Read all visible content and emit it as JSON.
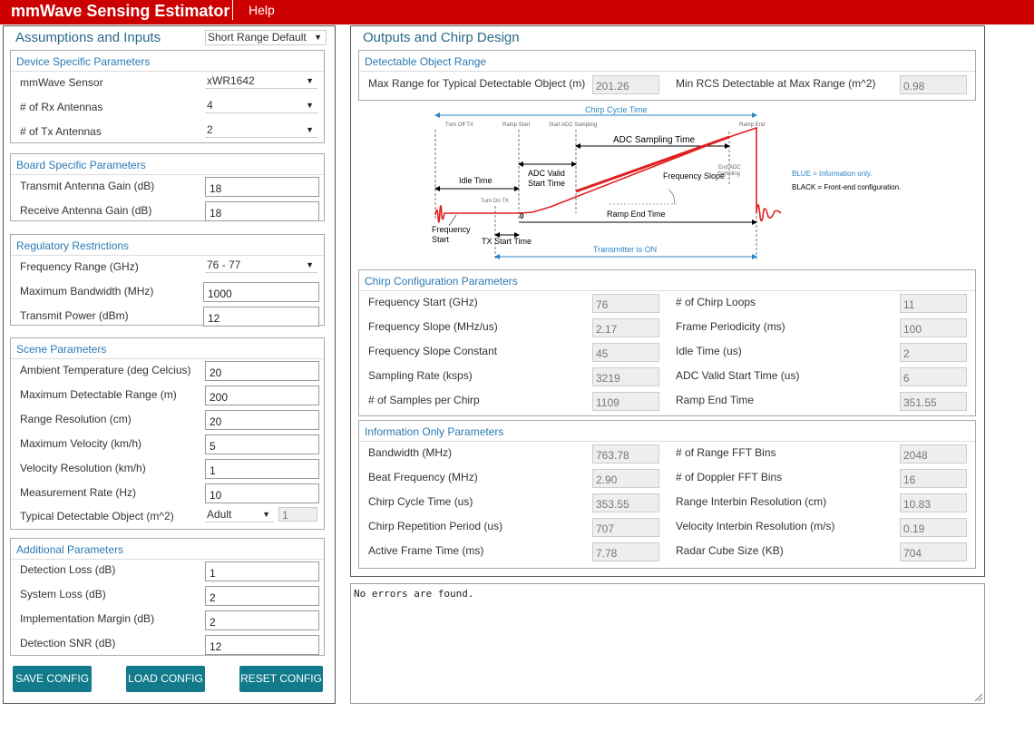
{
  "header": {
    "title": "mmWave Sensing Estimator",
    "help": "Help"
  },
  "left": {
    "title": "Assumptions and Inputs",
    "preset": "Short Range Default",
    "device": {
      "title": "Device Specific Parameters",
      "sensor_label": "mmWave Sensor",
      "sensor": "xWR1642",
      "rx_label": "# of Rx Antennas",
      "rx": "4",
      "tx_label": "# of Tx Antennas",
      "tx": "2"
    },
    "board": {
      "title": "Board Specific Parameters",
      "tx_gain_label": "Transmit Antenna Gain (dB)",
      "tx_gain": "18",
      "rx_gain_label": "Receive Antenna Gain (dB)",
      "rx_gain": "18"
    },
    "regulatory": {
      "title": "Regulatory Restrictions",
      "freq_label": "Frequency Range (GHz)",
      "freq": "76 - 77",
      "bw_label": "Maximum Bandwidth (MHz)",
      "bw": "1000",
      "power_label": "Transmit Power (dBm)",
      "power": "12"
    },
    "scene": {
      "title": "Scene Parameters",
      "temp_label": "Ambient Temperature (deg Celcius)",
      "temp": "20",
      "range_label": "Maximum Detectable Range (m)",
      "range": "200",
      "res_label": "Range Resolution (cm)",
      "res": "20",
      "vel_label": "Maximum Velocity (km/h)",
      "vel": "5",
      "velres_label": "Velocity Resolution (km/h)",
      "velres": "1",
      "rate_label": "Measurement Rate (Hz)",
      "rate": "10",
      "obj_label": "Typical Detectable Object (m^2)",
      "obj": "Adult",
      "obj_value": "1"
    },
    "additional": {
      "title": "Additional Parameters",
      "det_loss_label": "Detection Loss (dB)",
      "det_loss": "1",
      "sys_loss_label": "System Loss (dB)",
      "sys_loss": "2",
      "impl_label": "Implementation Margin (dB)",
      "impl": "2",
      "snr_label": "Detection SNR (dB)",
      "snr": "12"
    },
    "buttons": {
      "save": "SAVE CONFIG",
      "load": "LOAD CONFIG",
      "reset": "RESET CONFIG"
    }
  },
  "right": {
    "title": "Outputs and Chirp Design",
    "detect": {
      "title": "Detectable Object Range",
      "max_range_label": "Max Range for Typical Detectable Object (m)",
      "max_range": "201.26",
      "min_rcs_label": "Min RCS Detectable at Max Range (m^2)",
      "min_rcs": "0.98"
    },
    "diagram": {
      "chirp_cycle": "Chirp Cycle Time",
      "turn_off_tx": "Turn Off TX",
      "ramp_start": "Ramp Start",
      "start_adc": "Start ADC Sampling",
      "ramp_end": "Ramp End",
      "adc_sampling": "ADC Sampling Time",
      "end_adc_1": "End ADC",
      "end_adc_2": "Sampling",
      "adc_valid_1": "ADC Valid",
      "adc_valid_2": "Start Time",
      "freq_slope": "Frequency Slope",
      "idle_time": "Idle Time",
      "turn_on_tx": "Turn On TX",
      "zero": "0",
      "ramp_end_time": "Ramp End Time",
      "freq_start_1": "Frequency",
      "freq_start_2": "Start",
      "tx_start": "TX Start Time",
      "tx_on": "Transmitter is ON",
      "blue_note": "BLUE = Information only.",
      "black_note": "BLACK = Front-end configuration."
    },
    "chirp": {
      "title": "Chirp Configuration Parameters",
      "rows_left": [
        {
          "label": "Frequency Start (GHz)",
          "value": "76"
        },
        {
          "label": "Frequency Slope (MHz/us)",
          "value": "2.17"
        },
        {
          "label": "Frequency Slope Constant",
          "value": "45"
        },
        {
          "label": "Sampling Rate (ksps)",
          "value": "3219"
        },
        {
          "label": "# of Samples per Chirp",
          "value": "1109"
        }
      ],
      "rows_right": [
        {
          "label": "# of Chirp Loops",
          "value": "11"
        },
        {
          "label": "Frame Periodicity (ms)",
          "value": "100"
        },
        {
          "label": "Idle Time (us)",
          "value": "2"
        },
        {
          "label": "ADC Valid Start Time (us)",
          "value": "6"
        },
        {
          "label": "Ramp End Time",
          "value": "351.55"
        }
      ]
    },
    "info": {
      "title": "Information Only Parameters",
      "rows_left": [
        {
          "label": "Bandwidth (MHz)",
          "value": "763.78"
        },
        {
          "label": "Beat Frequency (MHz)",
          "value": "2.90"
        },
        {
          "label": "Chirp Cycle Time (us)",
          "value": "353.55"
        },
        {
          "label": "Chirp Repetition Period (us)",
          "value": "707"
        },
        {
          "label": "Active Frame Time (ms)",
          "value": "7.78"
        }
      ],
      "rows_right": [
        {
          "label": "# of Range FFT Bins",
          "value": "2048"
        },
        {
          "label": "# of Doppler FFT Bins",
          "value": "16"
        },
        {
          "label": "Range Interbin Resolution (cm)",
          "value": "10.83"
        },
        {
          "label": "Velocity Interbin Resolution (m/s)",
          "value": "0.19"
        },
        {
          "label": "Radar Cube Size (KB)",
          "value": "704"
        }
      ]
    }
  },
  "console": {
    "text": "No errors are found."
  }
}
